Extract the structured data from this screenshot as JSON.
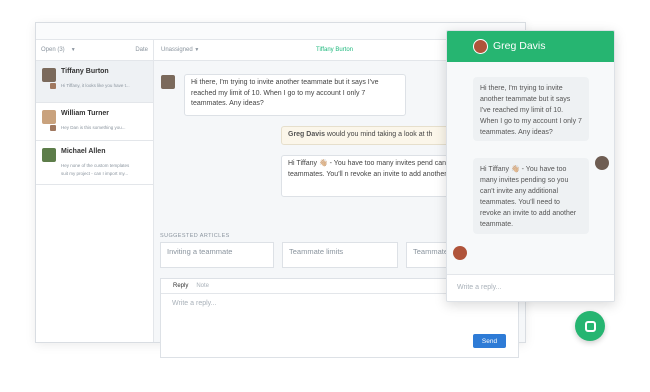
{
  "sidebar": {
    "filter_label": "Open (3)",
    "sort_label": "Date",
    "conversations": [
      {
        "name": "Tiffany Burton",
        "preview": "Hi Tiffany, it looks like you have t..."
      },
      {
        "name": "William Turner",
        "preview": "Hey Dan is this something you..."
      },
      {
        "name": "Michael Allen",
        "preview": "Hey none of the custom templates"
      },
      {
        "preview": "suit my project - can I import my..."
      }
    ]
  },
  "main": {
    "assignee_label": "Unassigned",
    "contact_name": "Tiffany Burton",
    "messages": [
      {
        "text": "Hi there, I'm trying to invite another teammate but it says I've reached my limit of 10. When I go to my account I only 7 teammates. Any ideas?"
      },
      {
        "author": "Greg Davis",
        "text": " would you mind taking a look at th"
      },
      {
        "text": "Hi Tiffany 👋🏼 - You have too many invites pend can't invite any additional teammates. You'll n revoke an invite to add another teammate."
      }
    ],
    "articles_label": "SUGGESTED ARTICLES",
    "articles": [
      "Inviting a teammate",
      "Teammate limits",
      "Teammate"
    ],
    "reply_tabs": [
      "Reply",
      "Note"
    ],
    "reply_placeholder": "Write a reply...",
    "send_label": "Send"
  },
  "widget": {
    "agent_name": "Greg Davis",
    "messages": [
      {
        "text": "Hi there, I'm trying to invite another teammate but it says I've reached my limit of 10. When I go to my account I only 7 teammates. Any ideas?"
      },
      {
        "text": "Hi Tiffany 👋🏼 - You have too many invites pending so you can't invite any additional teammates. You'll need to revoke an invite to add another teammate."
      }
    ],
    "input_placeholder": "Write a reply..."
  },
  "colors": {
    "brand_green": "#26b571",
    "send_blue": "#2e7bd6"
  },
  "icons": [
    "caret-down-icon",
    "chat-launcher-icon"
  ]
}
